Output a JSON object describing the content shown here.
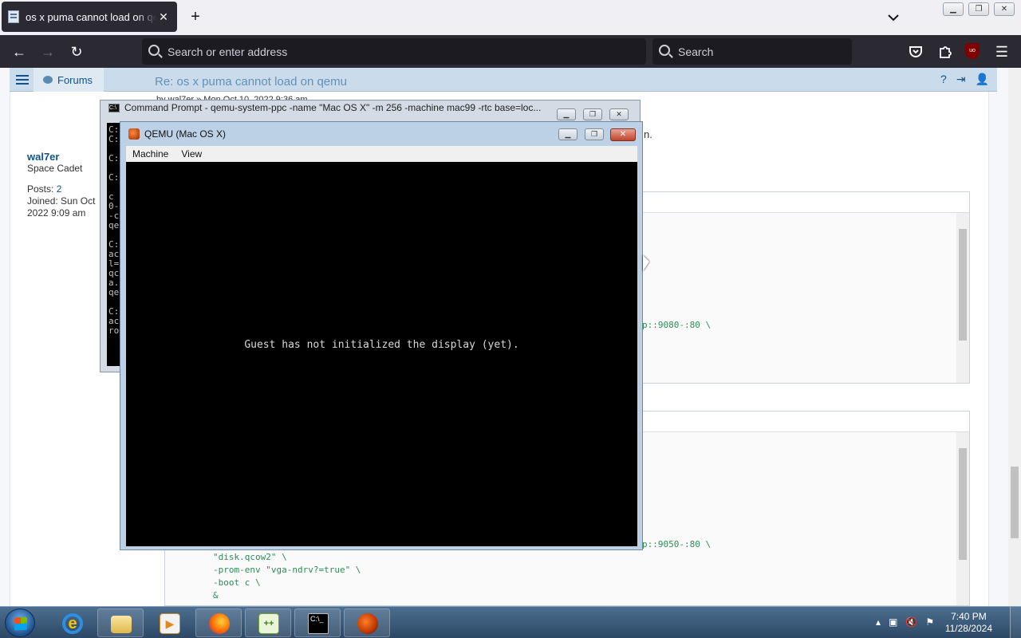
{
  "browser": {
    "tab_title": "os x puma cannot load on qemu",
    "tab_close": "✕",
    "new_tab": "+",
    "url_placeholder": "Search or enter address",
    "search_placeholder": "Search",
    "ublock_label": "uo"
  },
  "forum": {
    "nav_label": "Forums",
    "post_title": "Re: os x puma cannot load on qemu",
    "post_meta": "by wal7er » Mon Oct 10, 2022 9:36 am",
    "user": {
      "name": "wal7er",
      "rank": "Space Cadet",
      "posts_label": "Posts:",
      "posts_value": "2",
      "joined_label": "Joined:",
      "joined_value": "Sun Oct",
      "joined_value2": "2022 9:09 am"
    },
    "text_fragment": "n.",
    "code_lines_1": [
      "p::9080-:80 \\"
    ],
    "code_lines_2": [
      "p::9050-:80 \\",
      "\"disk.qcow2\" \\",
      "-prom-env \"vga-ndrv?=true\" \\",
      "-boot c \\",
      "&"
    ]
  },
  "cmd": {
    "title": "Command Prompt - qemu-system-ppc  -name \"Mac OS X\"  -m 256  -machine mac99  -rtc base=loc...",
    "lines": "C:\nC:\n\nC:\n\nC:\n \nc\n0-\n-c\nqe\n\nC:\nac\nl=\nqc\na.\nqe\n\nC:\nac\nro"
  },
  "qemu": {
    "title": "QEMU (Mac OS X)",
    "menu_machine": "Machine",
    "menu_view": "View",
    "message": "Guest has not initialized the display (yet).",
    "close": "✕"
  },
  "taskbar": {
    "time": "7:40 PM",
    "date": "11/28/2024"
  }
}
